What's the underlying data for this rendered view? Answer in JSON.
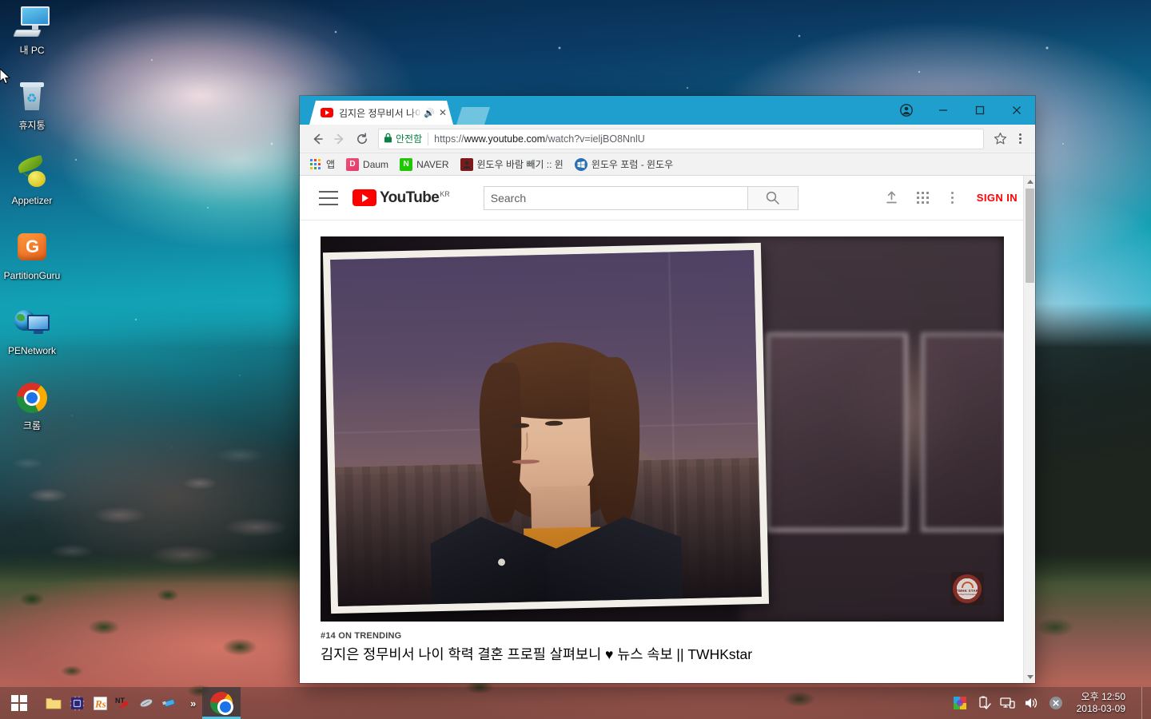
{
  "desktop": {
    "icons": [
      {
        "label": "내 PC",
        "icon": "computer-icon"
      },
      {
        "label": "휴지통",
        "icon": "recycle-bin-icon"
      },
      {
        "label": "Appetizer",
        "icon": "appetizer-icon"
      },
      {
        "label": "PartitionGuru",
        "icon": "partitionguru-icon"
      },
      {
        "label": "PENetwork",
        "icon": "penetwork-icon"
      },
      {
        "label": "크롬",
        "icon": "chrome-icon"
      }
    ]
  },
  "taskbar": {
    "start_label": "Start",
    "overflow_label": "»",
    "quick_items": [
      {
        "name": "folder-icon"
      },
      {
        "name": "cpu-icon"
      },
      {
        "name": "rs-icon"
      },
      {
        "name": "nt-key-icon"
      },
      {
        "name": "mouse-icon"
      },
      {
        "name": "usb-stick-icon"
      }
    ],
    "apps": [
      {
        "name": "chrome-taskbar-button",
        "label": "Chrome"
      }
    ],
    "tray": [
      {
        "name": "color-palette-icon"
      },
      {
        "name": "usb-eject-icon"
      },
      {
        "name": "network-icon"
      },
      {
        "name": "volume-icon"
      },
      {
        "name": "action-center-close-icon"
      }
    ],
    "clock": {
      "time": "오후 12:50",
      "date": "2018-03-09"
    }
  },
  "browser": {
    "tabs": [
      {
        "title": "김지은 정무비서 나이",
        "favicon": "youtube-favicon",
        "audio": true,
        "active": true
      }
    ],
    "new_tab_label": "+",
    "window_controls": {
      "profile": "profile-icon",
      "minimize": "−",
      "maximize": "□",
      "close": "×"
    },
    "toolbar": {
      "back": "←",
      "forward": "→",
      "reload": "⟳",
      "security_label": "안전함",
      "url": "https://www.youtube.com/watch?v=ieljBO8NnlU",
      "url_scheme": "https://",
      "url_host": "www.youtube.com",
      "url_path": "/watch?v=ieljBO8NnlU",
      "bookmark_star": "☆",
      "menu": "kebab-menu"
    },
    "bookmarks": [
      {
        "label": "앱",
        "icon": "apps-grid-icon"
      },
      {
        "label": "Daum",
        "icon": "daum-icon",
        "icon_char": "D",
        "color": "#e8476f"
      },
      {
        "label": "NAVER",
        "icon": "naver-icon",
        "icon_char": "N",
        "color": "#1ec800"
      },
      {
        "label": "윈도우 바람 빼기 :: 윈",
        "icon": "site-icon",
        "icon_char": "",
        "color": "#7a1a1a"
      },
      {
        "label": "윈도우 포럼 - 윈도우",
        "icon": "windows-forum-icon",
        "icon_char": "",
        "color": "#2b6fb5"
      }
    ]
  },
  "youtube": {
    "menu_label": "Guide",
    "logo_text": "YouTube",
    "logo_country": "KR",
    "search_placeholder": "Search",
    "search_value": "",
    "search_button": "search-icon",
    "header_actions": [
      {
        "name": "upload-icon"
      },
      {
        "name": "apps-icon"
      },
      {
        "name": "more-icon"
      }
    ],
    "sign_in_label": "SIGN IN",
    "video": {
      "trending_badge": "#14 ON TRENDING",
      "title": "김지은 정무비서 나이 학력 결혼 프로필 살펴보니 ♥ 뉴스 속보 || TWHKstar",
      "watermark": {
        "title": "TWHK STAR",
        "subtitle": "ENTERTAINMENT"
      }
    },
    "scrollbar": {
      "up": "▲",
      "down": "▼"
    }
  },
  "colors": {
    "chrome_frame": "#1f9fce",
    "youtube_red": "#ff0000",
    "secure_green": "#0b8043",
    "taskbar_accent": "#4fc3e8"
  }
}
